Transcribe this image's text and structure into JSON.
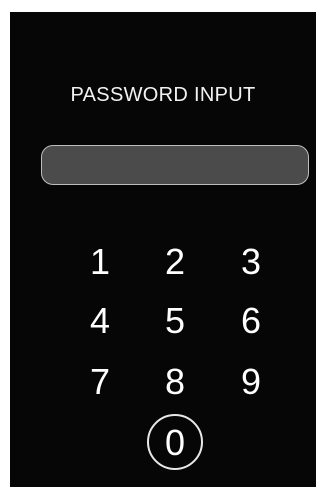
{
  "header": {
    "title": "PASSWORD INPUT"
  },
  "password": {
    "value": ""
  },
  "keypad": {
    "keys": [
      "1",
      "2",
      "3",
      "4",
      "5",
      "6",
      "7",
      "8",
      "9",
      "0"
    ]
  },
  "colors": {
    "background": "#060606",
    "field_fill": "#4b4b4b",
    "field_border": "#bdbdbd",
    "text": "#ffffff"
  }
}
